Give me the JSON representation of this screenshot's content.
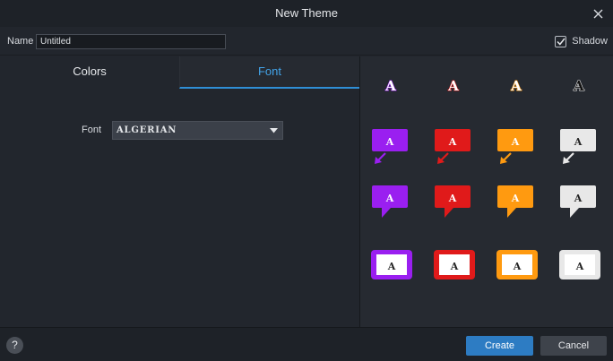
{
  "window": {
    "title": "New Theme"
  },
  "name_field": {
    "label": "Name",
    "value": "Untitled"
  },
  "shadow": {
    "label": "Shadow",
    "checked": true
  },
  "tabs": [
    {
      "label": "Colors",
      "active": false
    },
    {
      "label": "Font",
      "active": true
    }
  ],
  "font": {
    "label": "Font",
    "value": "ALGERIAN"
  },
  "preview": {
    "glyph": "A",
    "colors": [
      "#9a1ff0",
      "#e01a1a",
      "#ff9a10",
      "#e8e8e8"
    ],
    "rows": [
      "text-only",
      "callout-arrow",
      "speech-bubble",
      "framed-box"
    ]
  },
  "footer": {
    "help": "?",
    "create": "Create",
    "cancel": "Cancel"
  }
}
